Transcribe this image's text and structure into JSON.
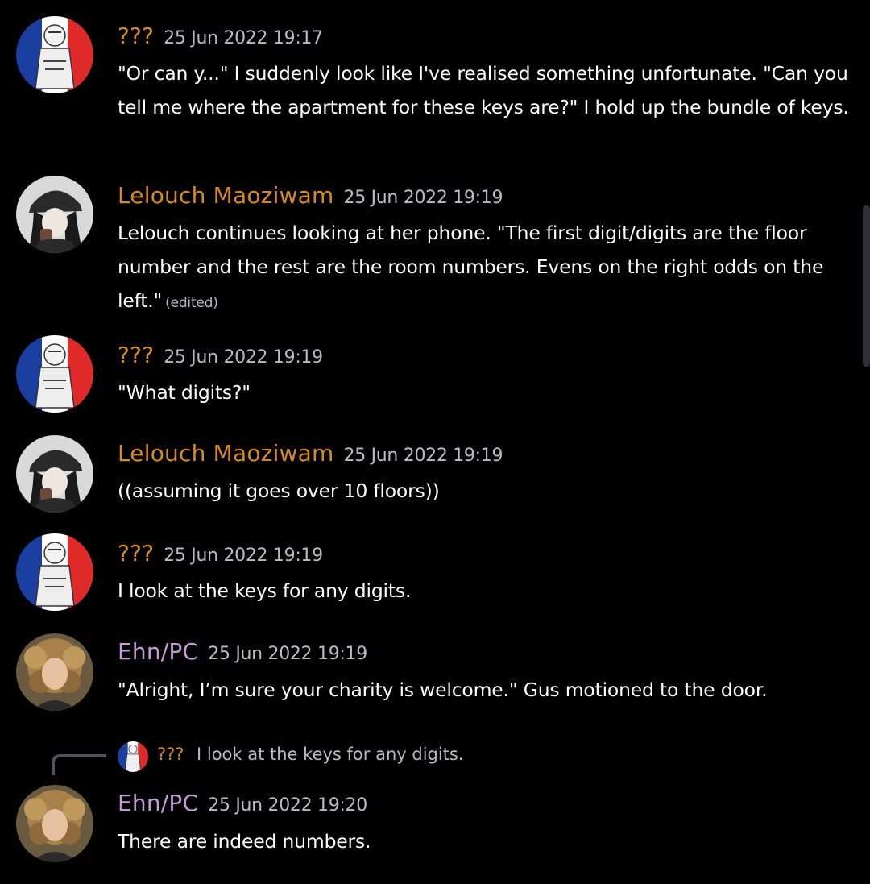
{
  "colors": {
    "background": "#000000",
    "timestamp": "#b9bbbe",
    "text": "#ffffff",
    "unknown_author": "#d58a21",
    "lelouch_author": "#d58a21",
    "ehn_author": "#c49bd6"
  },
  "messages": [
    {
      "author": "???",
      "author_color": "#d58a21",
      "timestamp": "25 Jun 2022 19:17",
      "avatar": "french-flag-character-avatar",
      "content": "\"Or can y...\" I suddenly look like I've realised something unfortunate. \"Can you tell me where the apartment for these keys are?\" I hold up the bundle of keys."
    },
    {
      "author": "Lelouch Maoziwam",
      "author_color": "#d58a21",
      "timestamp": "25 Jun 2022 19:19",
      "avatar": "anime-girl-cap-avatar",
      "content": "Lelouch continues looking at her phone. \"The first digit/digits are the floor number and the rest are the room numbers. Evens on the right odds on the left.\"",
      "edited": "(edited)"
    },
    {
      "author": "???",
      "author_color": "#d58a21",
      "timestamp": "25 Jun 2022 19:19",
      "avatar": "french-flag-character-avatar",
      "content": "\"What digits?\""
    },
    {
      "author": "Lelouch Maoziwam",
      "author_color": "#d58a21",
      "timestamp": "25 Jun 2022 19:19",
      "avatar": "anime-girl-cap-avatar",
      "content": "((assuming it goes over 10 floors))"
    },
    {
      "author": "???",
      "author_color": "#d58a21",
      "timestamp": "25 Jun 2022 19:19",
      "avatar": "french-flag-character-avatar",
      "content": "I look at the keys for any digits."
    },
    {
      "author": "Ehn/PC",
      "author_color": "#c49bd6",
      "timestamp": "25 Jun 2022 19:19",
      "avatar": "curly-hair-woman-avatar",
      "content": "\"Alright, I’m sure your charity is welcome.\" Gus motioned to the door."
    },
    {
      "author": "Ehn/PC",
      "author_color": "#c49bd6",
      "timestamp": "25 Jun 2022 19:20",
      "avatar": "curly-hair-woman-avatar",
      "content": "There are indeed numbers."
    }
  ],
  "reply": {
    "author": "???",
    "author_color": "#d58a21",
    "text": "I look at the keys for any digits."
  }
}
